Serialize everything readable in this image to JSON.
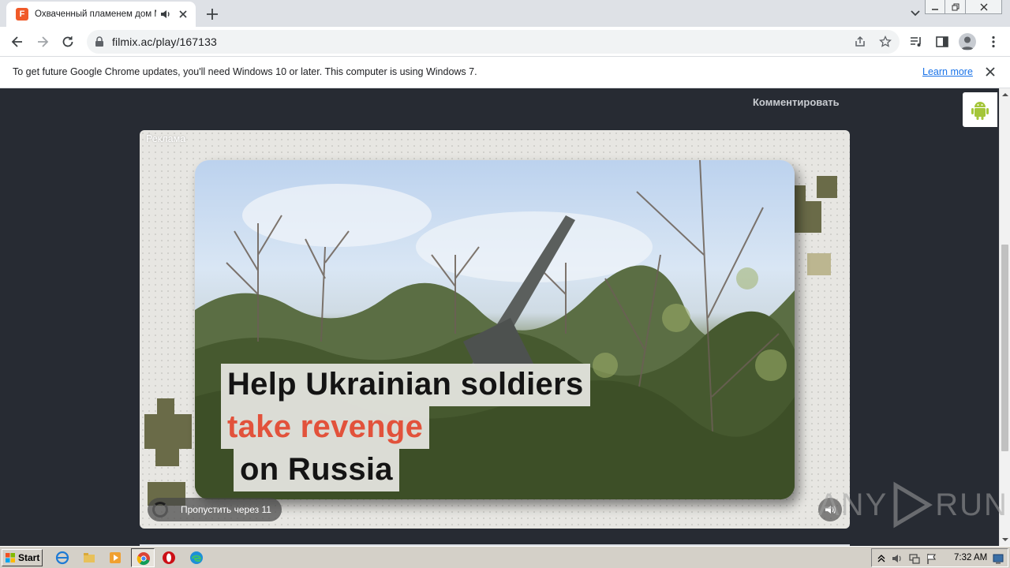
{
  "browser": {
    "tab": {
      "favicon_letter": "F",
      "title": "Охваченный пламенем дом Ми",
      "favicon_color": "#f05a28"
    },
    "url": "filmix.ac/play/167133",
    "icons": [
      "back-icon",
      "forward-icon",
      "reload-icon",
      "lock-icon",
      "share-icon",
      "bookmark-star-icon",
      "media-control-icon",
      "side-panel-icon",
      "profile-icon",
      "menu-icon"
    ]
  },
  "infobar": {
    "message": "To get future Google Chrome updates, you'll need Windows 10 or later. This computer is using Windows 7.",
    "link": "Learn more"
  },
  "page": {
    "comment_link": "Комментировать",
    "background": "#272b33"
  },
  "ad": {
    "label": "Реклама",
    "headline": {
      "line1": "Help Ukrainian soldiers",
      "line2": "take revenge",
      "line3": "on Russia"
    },
    "headline_accent": "#e2523b",
    "skip_text": "Пропустить через 11"
  },
  "watermark": {
    "left": "ANY",
    "right": "RUN"
  },
  "taskbar": {
    "start_label": "Start",
    "clock": "7:32 AM"
  }
}
